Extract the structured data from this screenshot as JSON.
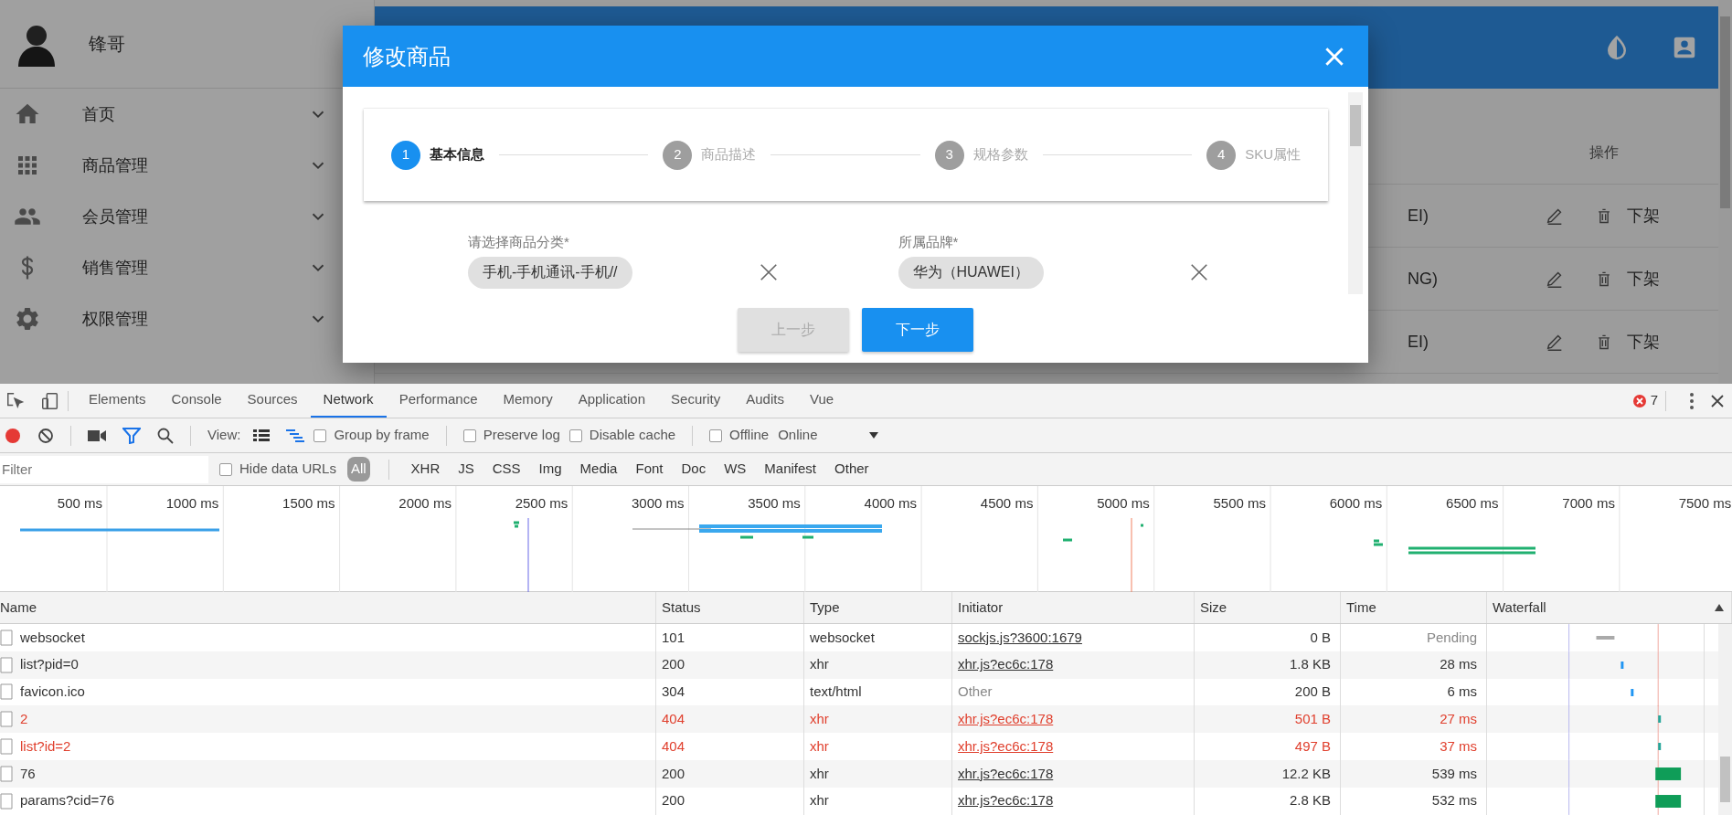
{
  "app": {
    "user": {
      "name": "锋哥"
    },
    "menu": [
      {
        "label": "首页"
      },
      {
        "label": "商品管理"
      },
      {
        "label": "会员管理"
      },
      {
        "label": "销售管理"
      },
      {
        "label": "权限管理"
      }
    ],
    "table": {
      "action_header": "操作",
      "rows": [
        {
          "cell": "EI)",
          "action": "下架"
        },
        {
          "cell": "NG)",
          "action": "下架"
        },
        {
          "cell": "EI)",
          "action": "下架"
        }
      ]
    }
  },
  "dialog": {
    "title": "修改商品",
    "steps": [
      {
        "number": "1",
        "label": "基本信息",
        "selected": true
      },
      {
        "number": "2",
        "label": "商品描述",
        "selected": false
      },
      {
        "number": "3",
        "label": "规格参数",
        "selected": false
      },
      {
        "number": "4",
        "label": "SKU属性",
        "selected": false
      }
    ],
    "fields": [
      {
        "label": "请选择商品分类*",
        "value": "手机-手机通讯-手机//"
      },
      {
        "label": "所属品牌*",
        "value": "华为（HUAWEI）"
      }
    ],
    "buttons": [
      {
        "label": "上一步",
        "disabled": true
      },
      {
        "label": "下一步",
        "disabled": false
      }
    ]
  },
  "devtools": {
    "tabs": [
      {
        "label": "Elements",
        "selected": false
      },
      {
        "label": "Console",
        "selected": false
      },
      {
        "label": "Sources",
        "selected": false
      },
      {
        "label": "Network",
        "selected": true
      },
      {
        "label": "Performance",
        "selected": false
      },
      {
        "label": "Memory",
        "selected": false
      },
      {
        "label": "Application",
        "selected": false
      },
      {
        "label": "Security",
        "selected": false
      },
      {
        "label": "Audits",
        "selected": false
      },
      {
        "label": "Vue",
        "selected": false
      }
    ],
    "error_count": "7",
    "recording": true,
    "view_label": "View:",
    "options": [
      {
        "label": "Group by frame",
        "checked": false
      },
      {
        "label": "Preserve log",
        "checked": false
      },
      {
        "label": "Disable cache",
        "checked": false
      },
      {
        "label": "Offline",
        "checked": false
      }
    ],
    "throttling": "Online",
    "filter": {
      "placeholder": "Filter"
    },
    "hide_data_urls": {
      "label": "Hide data URLs",
      "checked": false
    },
    "type_filters": [
      {
        "label": "All",
        "selected": true
      },
      {
        "label": "XHR",
        "selected": false
      },
      {
        "label": "JS",
        "selected": false
      },
      {
        "label": "CSS",
        "selected": false
      },
      {
        "label": "Img",
        "selected": false
      },
      {
        "label": "Media",
        "selected": false
      },
      {
        "label": "Font",
        "selected": false
      },
      {
        "label": "Doc",
        "selected": false
      },
      {
        "label": "WS",
        "selected": false
      },
      {
        "label": "Manifest",
        "selected": false
      },
      {
        "label": "Other",
        "selected": false
      }
    ],
    "overview_ticks": [
      "500 ms",
      "1000 ms",
      "1500 ms",
      "2000 ms",
      "2500 ms",
      "3000 ms",
      "3500 ms",
      "4000 ms",
      "4500 ms",
      "5000 ms",
      "5500 ms",
      "6000 ms",
      "6500 ms",
      "7000 ms",
      "7500 ms"
    ],
    "table": {
      "columns": [
        "Name",
        "Status",
        "Type",
        "Initiator",
        "Size",
        "Time",
        "Waterfall"
      ],
      "rows": [
        {
          "name": "websocket",
          "status": "101",
          "type": "websocket",
          "initiator": "sockjs.js?3600:1679",
          "initiator_link": true,
          "size": "0 B",
          "time": "Pending",
          "pending": true,
          "failed": false
        },
        {
          "name": "list?pid=0",
          "status": "200",
          "type": "xhr",
          "initiator": "xhr.js?ec6c:178",
          "initiator_link": true,
          "size": "1.8 KB",
          "time": "28 ms",
          "pending": false,
          "failed": false
        },
        {
          "name": "favicon.ico",
          "status": "304",
          "type": "text/html",
          "initiator": "Other",
          "initiator_link": false,
          "size": "200 B",
          "time": "6 ms",
          "pending": false,
          "failed": false
        },
        {
          "name": "2",
          "status": "404",
          "type": "xhr",
          "initiator": "xhr.js?ec6c:178",
          "initiator_link": true,
          "size": "501 B",
          "time": "27 ms",
          "pending": false,
          "failed": true
        },
        {
          "name": "list?id=2",
          "status": "404",
          "type": "xhr",
          "initiator": "xhr.js?ec6c:178",
          "initiator_link": true,
          "size": "497 B",
          "time": "37 ms",
          "pending": false,
          "failed": true
        },
        {
          "name": "76",
          "status": "200",
          "type": "xhr",
          "initiator": "xhr.js?ec6c:178",
          "initiator_link": true,
          "size": "12.2 KB",
          "time": "539 ms",
          "pending": false,
          "failed": false
        },
        {
          "name": "params?cid=76",
          "status": "200",
          "type": "xhr",
          "initiator": "xhr.js?ec6c:178",
          "initiator_link": true,
          "size": "2.8 KB",
          "time": "532 ms",
          "pending": false,
          "failed": false
        }
      ]
    }
  }
}
